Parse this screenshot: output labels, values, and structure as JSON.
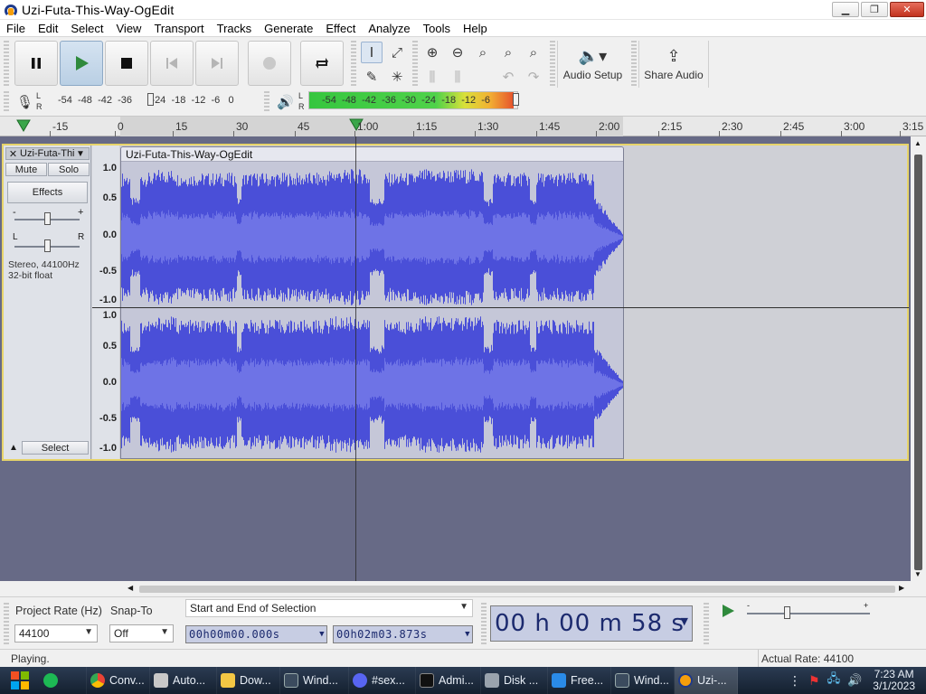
{
  "window": {
    "title": "Uzi-Futa-This-Way-OgEdit"
  },
  "menu": [
    "File",
    "Edit",
    "Select",
    "View",
    "Transport",
    "Tracks",
    "Generate",
    "Effect",
    "Analyze",
    "Tools",
    "Help"
  ],
  "toolbar": {
    "audio_setup_label": "Audio Setup",
    "share_audio_label": "Share Audio"
  },
  "meters": {
    "rec_scale": [
      "-54",
      "-48",
      "-42",
      "-36",
      "-24",
      "-18",
      "-12",
      "-6",
      "0"
    ],
    "play_scale": [
      "-54",
      "-48",
      "-42",
      "-36",
      "-30",
      "-24",
      "-18",
      "-12",
      "-6"
    ],
    "lr": [
      "L",
      "R"
    ]
  },
  "ruler": {
    "ticks": [
      "-15",
      "0",
      "15",
      "30",
      "45",
      "1:00",
      "1:15",
      "1:30",
      "1:45",
      "2:00",
      "2:15",
      "2:30",
      "2:45",
      "3:00",
      "3:15"
    ]
  },
  "track": {
    "name": "Uzi-Futa-Thi",
    "mute": "Mute",
    "solo": "Solo",
    "effects": "Effects",
    "pan_l": "L",
    "pan_r": "R",
    "info_line1": "Stereo, 44100Hz",
    "info_line2": "32-bit float",
    "select": "Select",
    "clip_title": "Uzi-Futa-This-Way-OgEdit",
    "y_labels": [
      "1.0",
      "0.5",
      "0.0",
      "-0.5",
      "-1.0"
    ]
  },
  "selection_toolbar": {
    "project_rate_label": "Project Rate (Hz)",
    "project_rate_value": "44100",
    "snap_to_label": "Snap-To",
    "snap_to_value": "Off",
    "selection_mode": "Start and End of Selection",
    "start_time": "00h00m00.000s",
    "end_time": "00h02m03.873s",
    "position": "00 h 00 m 58 s"
  },
  "status": {
    "left": "Playing.",
    "right": "Actual Rate: 44100"
  },
  "taskbar": {
    "items": [
      "Conv...",
      "Auto...",
      "Dow...",
      "Wind...",
      "#sex...",
      "Admi...",
      "Disk ...",
      "Free...",
      "Wind...",
      "Uzi-..."
    ],
    "time": "7:23 AM",
    "date": "3/1/2023"
  },
  "colors": {
    "waveform": "#4a4fd8",
    "waveform_rms": "#6e73e6",
    "track_border": "#e7d46a",
    "timer_bg": "#c7cde3",
    "timer_text": "#1c2a6e"
  }
}
